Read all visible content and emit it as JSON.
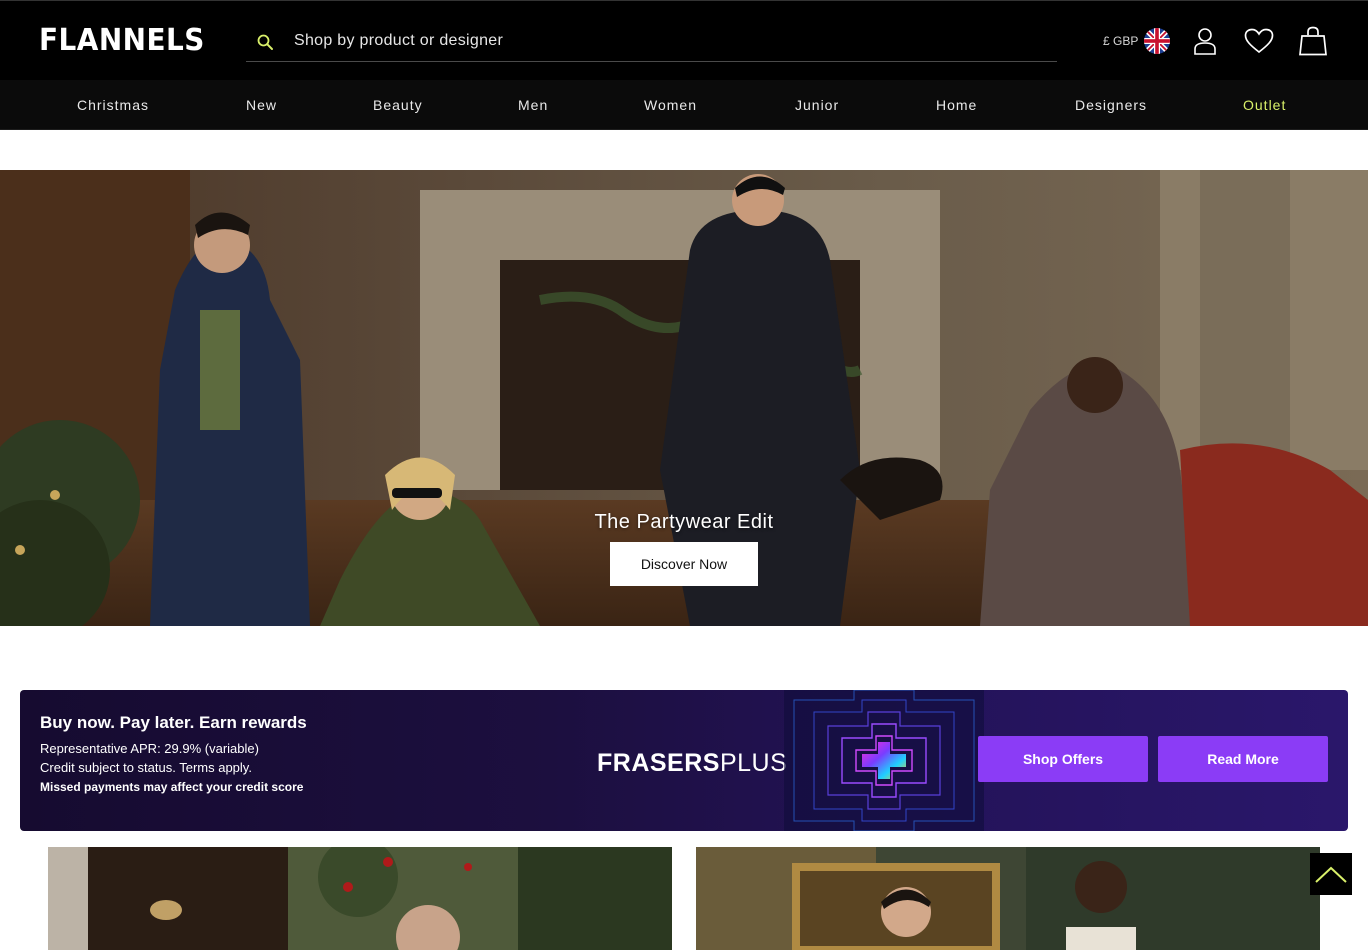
{
  "header": {
    "logo": "FLANNELS",
    "search": {
      "placeholder": "Shop by product or designer",
      "value": ""
    },
    "currency": "£ GBP",
    "icons": [
      "search-icon",
      "uk-flag-icon",
      "account-icon",
      "heart-icon",
      "bag-icon"
    ]
  },
  "nav": {
    "items": [
      {
        "label": "Christmas"
      },
      {
        "label": "New"
      },
      {
        "label": "Beauty"
      },
      {
        "label": "Men"
      },
      {
        "label": "Women"
      },
      {
        "label": "Junior"
      },
      {
        "label": "Home"
      },
      {
        "label": "Designers"
      },
      {
        "label": "Outlet"
      }
    ],
    "outlet_color": "#d9f06a"
  },
  "hero": {
    "title": "The Partywear Edit",
    "button_label": "Discover Now"
  },
  "frasers_plus": {
    "title": "Buy now. Pay later. Earn rewards",
    "line1": "Representative APR: 29.9% (variable)",
    "line2": "Credit subject to status. Terms apply.",
    "line3": "Missed payments may affect your credit score",
    "logo_bold": "FRASERS",
    "logo_light": "PLUS",
    "shop_label": "Shop Offers",
    "read_label": "Read More",
    "accent_color": "#8b3cf6"
  },
  "colors": {
    "header_bg": "#000000",
    "nav_bg": "#0b0b0b"
  }
}
